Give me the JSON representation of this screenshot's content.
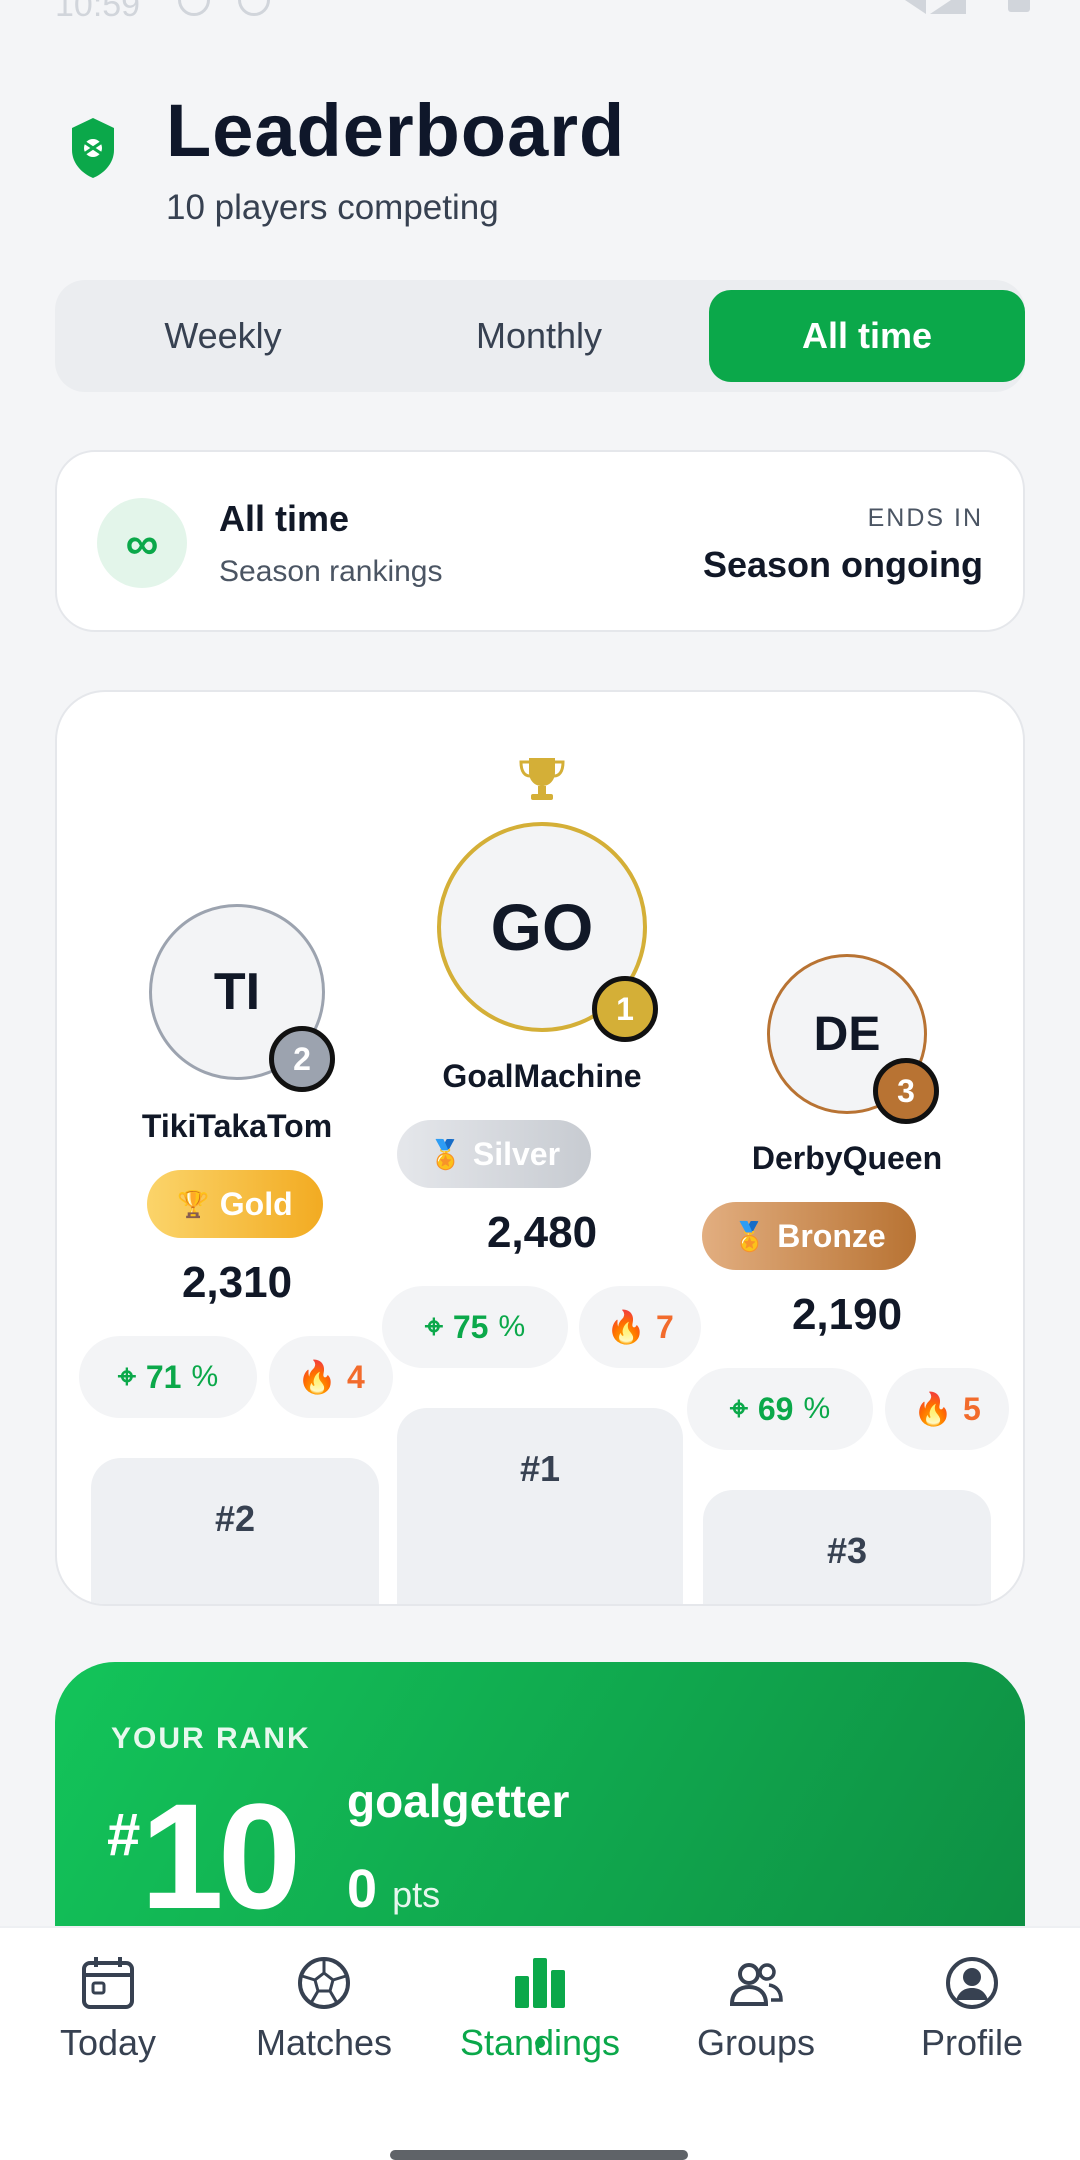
{
  "status": {
    "time": "10:59"
  },
  "header": {
    "title": "Leaderboard",
    "subtitle": "10 players competing"
  },
  "tabs": [
    {
      "label": "Weekly",
      "active": false
    },
    {
      "label": "Monthly",
      "active": false
    },
    {
      "label": "All time",
      "active": true
    }
  ],
  "period": {
    "title": "All time",
    "subtitle": "Season rankings",
    "ends_label": "ENDS IN",
    "ends_value": "Season ongoing",
    "icon": "infinity-icon"
  },
  "podium": {
    "first": {
      "initials": "GO",
      "rank": "1",
      "name": "GoalMachine",
      "tier": "Silver",
      "points": "2,480",
      "accuracy": "75",
      "accuracy_unit": "%",
      "streak": "7",
      "block_label": "#1"
    },
    "second": {
      "initials": "TI",
      "rank": "2",
      "name": "TikiTakaTom",
      "tier": "Gold",
      "points": "2,310",
      "accuracy": "71",
      "accuracy_unit": "%",
      "streak": "4",
      "block_label": "#2"
    },
    "third": {
      "initials": "DE",
      "rank": "3",
      "name": "DerbyQueen",
      "tier": "Bronze",
      "points": "2,190",
      "accuracy": "69",
      "accuracy_unit": "%",
      "streak": "5",
      "block_label": "#3"
    }
  },
  "your_rank": {
    "label": "YOUR RANK",
    "hash": "#",
    "rank": "10",
    "name": "goalgetter",
    "points": "0",
    "points_unit": "pts"
  },
  "nav": [
    {
      "label": "Today",
      "icon": "calendar-icon",
      "active": false
    },
    {
      "label": "Matches",
      "icon": "soccer-ball-icon",
      "active": false
    },
    {
      "label": "Standings",
      "icon": "bar-chart-icon",
      "active": true
    },
    {
      "label": "Groups",
      "icon": "people-icon",
      "active": false
    },
    {
      "label": "Profile",
      "icon": "user-circle-icon",
      "active": false
    }
  ],
  "colors": {
    "accent": "#0BA84A",
    "gold": "#D4AF37",
    "silver": "#9CA3AF",
    "bronze": "#B87333",
    "streak": "#F26B2C"
  }
}
